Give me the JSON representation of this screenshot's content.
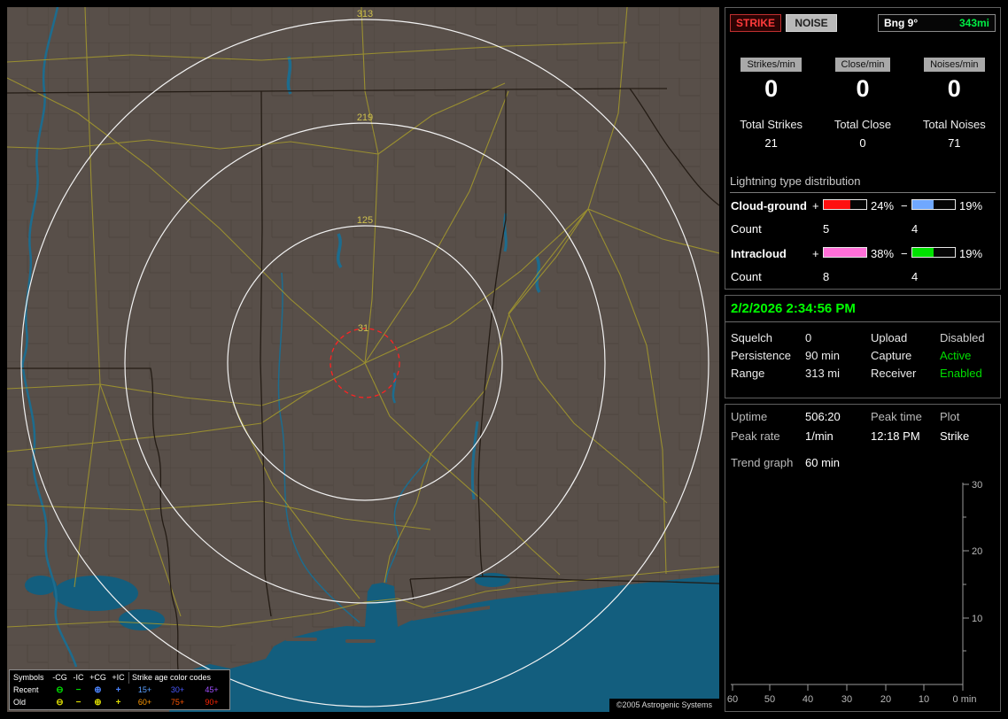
{
  "map": {
    "rings": [
      {
        "label": "313"
      },
      {
        "label": "219"
      },
      {
        "label": "125"
      },
      {
        "label": "31"
      }
    ],
    "copyright": "©2005 Astrogenic Systems",
    "legend": {
      "header": [
        "Symbols",
        "-CG",
        "-IC",
        "+CG",
        "+IC",
        "Strike age color codes"
      ],
      "rows": [
        {
          "label": "Recent",
          "symbols": [
            {
              "glyph": "⊖",
              "color": "#00dd00"
            },
            {
              "glyph": "−",
              "color": "#00dd00"
            },
            {
              "glyph": "⊕",
              "color": "#4d86ff"
            },
            {
              "glyph": "+",
              "color": "#4d86ff"
            }
          ],
          "ages": [
            {
              "text": "15+",
              "color": "#5aa0ff"
            },
            {
              "text": "30+",
              "color": "#4a5aff"
            },
            {
              "text": "45+",
              "color": "#a050ff"
            }
          ]
        },
        {
          "label": "Old",
          "symbols": [
            {
              "glyph": "⊖",
              "color": "#dddd00"
            },
            {
              "glyph": "−",
              "color": "#dddd00"
            },
            {
              "glyph": "⊕",
              "color": "#dddd00"
            },
            {
              "glyph": "+",
              "color": "#dddd00"
            }
          ],
          "ages": [
            {
              "text": "60+",
              "color": "#ff9900"
            },
            {
              "text": "75+",
              "color": "#ff5500"
            },
            {
              "text": "90+",
              "color": "#ff2200"
            }
          ]
        }
      ]
    }
  },
  "panel": {
    "toolbar": {
      "strike": "STRIKE",
      "noise": "NOISE",
      "bearing": "Bng 9°",
      "range": "343mi",
      "range_color": "#00ee44"
    },
    "counters": [
      {
        "label": "Strikes/min",
        "value": "0",
        "total_label": "Total Strikes",
        "total": "21"
      },
      {
        "label": "Close/min",
        "value": "0",
        "total_label": "Total Close",
        "total": "0"
      },
      {
        "label": "Noises/min",
        "value": "0",
        "total_label": "Total Noises",
        "total": "71"
      }
    ],
    "distribution": {
      "title": "Lightning type distribution",
      "rows": [
        {
          "name": "Cloud-ground",
          "plus_sign": "+",
          "minus_sign": "−",
          "plus_pct": "24%",
          "minus_pct": "19%",
          "plus_color": "#ff1010",
          "minus_color": "#6fa8ff",
          "plus_fill": 63,
          "minus_fill": 50,
          "count_label": "Count",
          "plus_count": "5",
          "minus_count": "4"
        },
        {
          "name": "Intracloud",
          "plus_sign": "+",
          "minus_sign": "−",
          "plus_pct": "38%",
          "minus_pct": "19%",
          "plus_color": "#ff6fd8",
          "minus_color": "#00e000",
          "plus_fill": 100,
          "minus_fill": 50,
          "count_label": "Count",
          "plus_count": "8",
          "minus_count": "4"
        }
      ]
    },
    "status": {
      "datetime": "2/2/2026 2:34:56 PM",
      "datetime_color": "#00ff00",
      "rows": [
        {
          "label1": "Squelch",
          "value1": "0",
          "label2": "Upload",
          "value2": "Disabled",
          "value2_color": "#cfcfcf"
        },
        {
          "label1": "Persistence",
          "value1": "90 min",
          "label2": "Capture",
          "value2": "Active",
          "value2_color": "#00e000"
        },
        {
          "label1": "Range",
          "value1": "313 mi",
          "label2": "Receiver",
          "value2": "Enabled",
          "value2_color": "#00e000"
        }
      ]
    },
    "stats": {
      "rows": [
        {
          "c1": "Uptime",
          "c2": "506:20",
          "c3": "Peak time",
          "c4": "Plot"
        },
        {
          "c1": "Peak rate",
          "c2": "1/min",
          "c3": "12:18 PM",
          "c4": "Strike"
        }
      ],
      "trend_label": "Trend graph",
      "trend_value": "60 min"
    },
    "chart_data": {
      "type": "line",
      "title": "Trend graph",
      "x_ticks": [
        "60",
        "50",
        "40",
        "30",
        "20",
        "10",
        "0 min"
      ],
      "y_ticks": [
        "30",
        "20",
        "10"
      ],
      "xlabel": "min",
      "ylim": [
        0,
        30
      ],
      "x_range_minutes_ago": [
        60,
        0
      ],
      "legend_position": "none",
      "grid": false,
      "series": [
        {
          "name": "Strike",
          "values": []
        }
      ],
      "note": "trend graph currently empty - no strikes plotted"
    }
  }
}
